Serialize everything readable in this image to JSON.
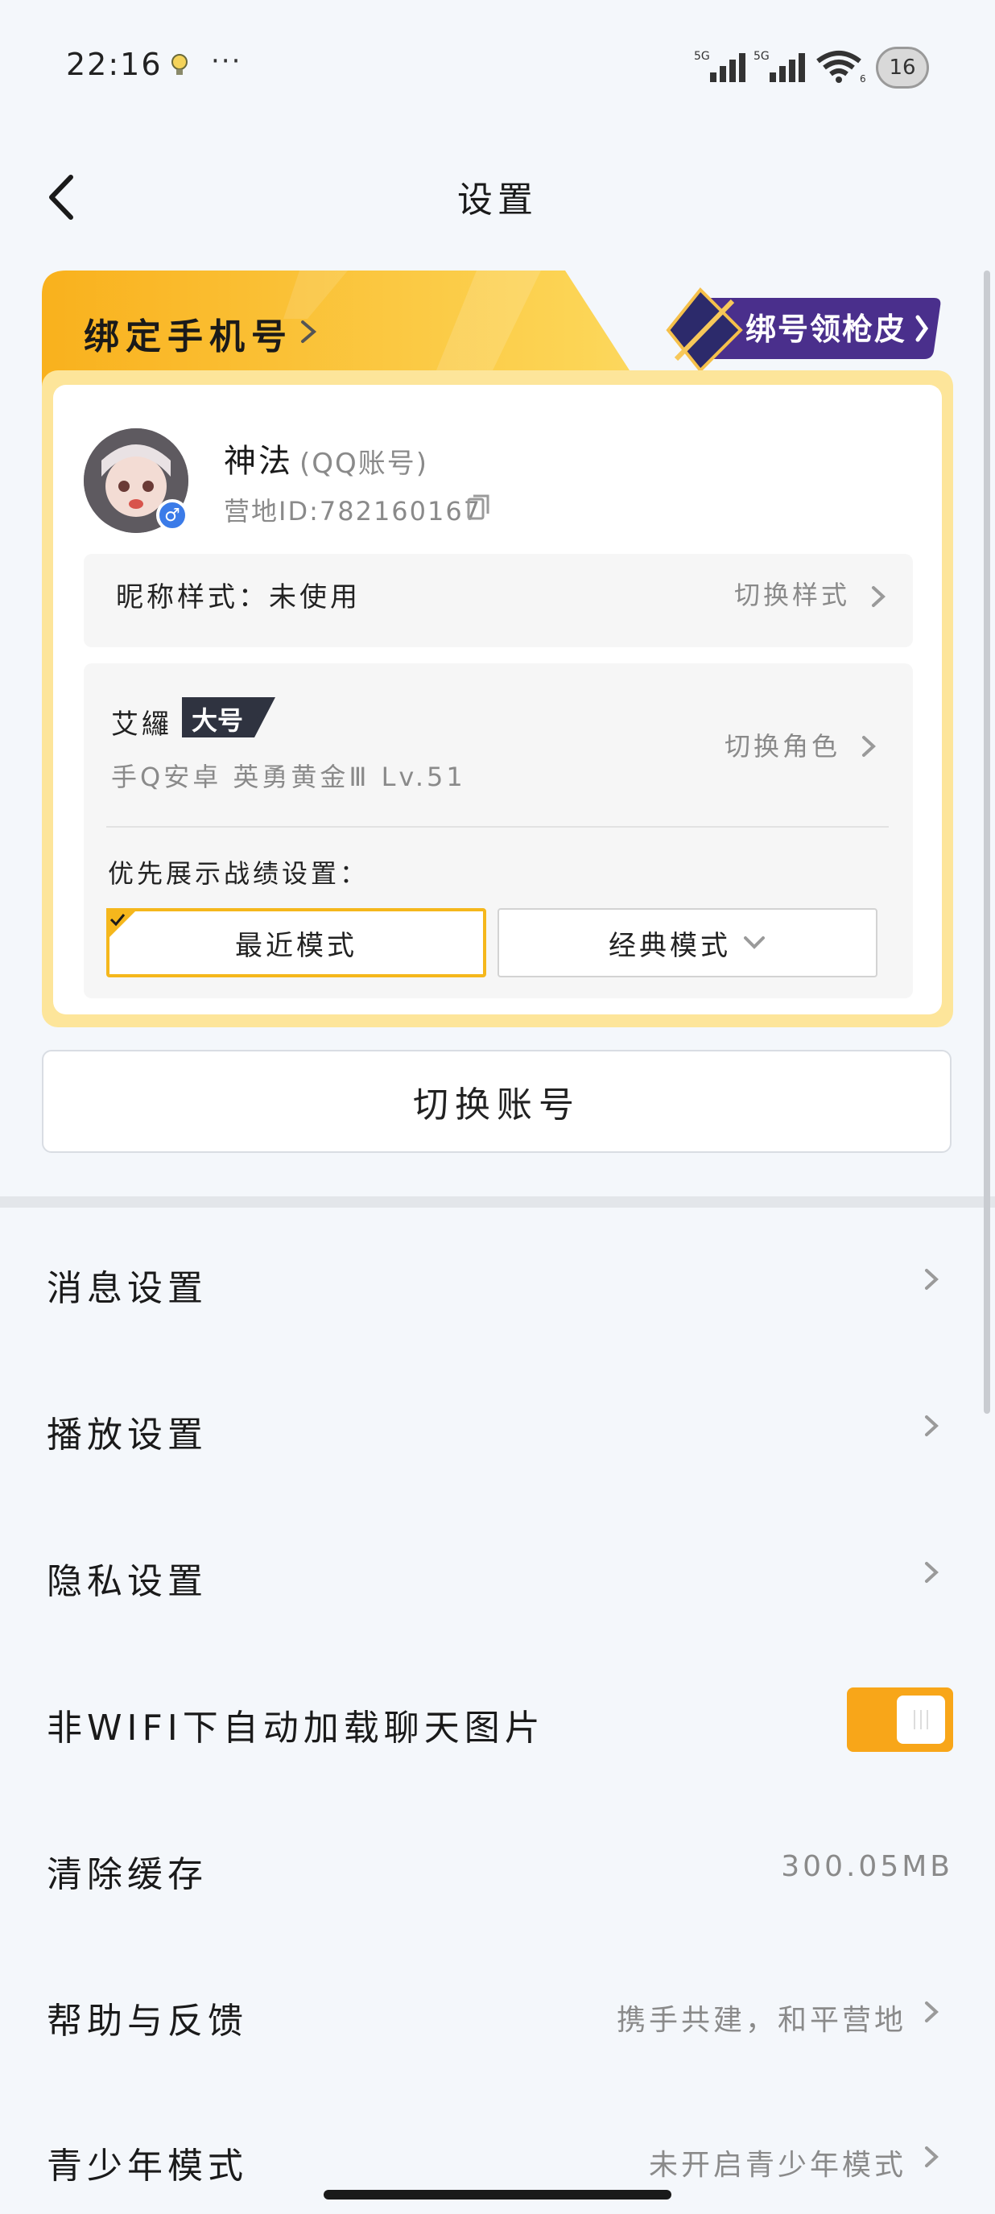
{
  "status_bar": {
    "time": "22:16",
    "dots": "···",
    "network_label_1": "5G",
    "network_label_2": "5G",
    "wifi_label": "6",
    "battery": "16"
  },
  "header": {
    "title": "设置",
    "back_icon": "chevron-left-icon"
  },
  "bind_card": {
    "bind_phone_label": "绑定手机号",
    "promo_label": "绑号领枪皮",
    "accent_color": "#f8b219",
    "profile": {
      "name": "神法",
      "account_type": "(QQ账号)",
      "camp_id": "营地ID:782160167",
      "gender_symbol": "♂"
    },
    "nickname_style": {
      "label": "昵称样式：未使用",
      "action": "切换样式"
    },
    "role": {
      "name": "艾纙",
      "badge": "大号",
      "detail": "手Q安卓  英勇黄金Ⅲ  Lv.51",
      "switch_label": "切换角色"
    },
    "record_pref": {
      "label": "优先展示战绩设置：",
      "recent_mode": "最近模式",
      "classic_mode": "经典模式"
    }
  },
  "switch_account_label": "切换账号",
  "settings": {
    "message": "消息设置",
    "playback": "播放设置",
    "privacy": "隐私设置",
    "auto_load_images": "非WIFI下自动加载聊天图片",
    "auto_load_images_on": true,
    "clear_cache": "清除缓存",
    "cache_size": "300.05MB",
    "help_feedback": "帮助与反馈",
    "help_feedback_value": "携手共建，和平营地",
    "teen_mode": "青少年模式",
    "teen_mode_value": "未开启青少年模式"
  },
  "colors": {
    "toggle_on": "#f8a619",
    "promo_bg": "#5a3c9a"
  }
}
